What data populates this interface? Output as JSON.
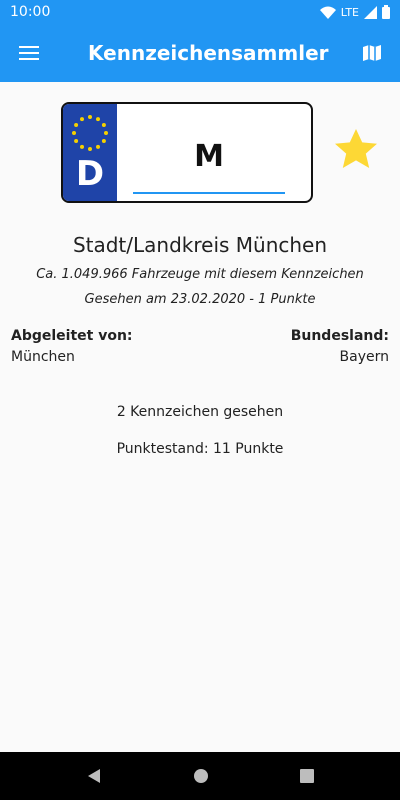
{
  "status_bar": {
    "time": "10:00",
    "network": "LTE"
  },
  "app_bar": {
    "title": "Kennzeichensammler"
  },
  "plate": {
    "country_code": "D",
    "text": "M"
  },
  "city": {
    "name": "Stadt/Landkreis München"
  },
  "info": {
    "vehicles": "Ca. 1.049.966 Fahrzeuge mit diesem Kennzeichen",
    "seen_on": "Gesehen am 23.02.2020 - 1 Punkte"
  },
  "details": {
    "derived_label": "Abgeleitet von:",
    "derived_value": "München",
    "state_label": "Bundesland:",
    "state_value": "Bayern"
  },
  "stats": {
    "seen_count": "2 Kennzeichen gesehen",
    "score": "Punktestand: 11 Punkte"
  },
  "colors": {
    "primary": "#2196f3",
    "eu_blue": "#1f44a8",
    "star": "#fdd835"
  },
  "icons": [
    "wifi-icon",
    "signal-icon",
    "battery-icon",
    "menu-icon",
    "map-icon",
    "star-icon",
    "eu-stars-icon",
    "back-icon",
    "home-icon",
    "recents-icon"
  ]
}
